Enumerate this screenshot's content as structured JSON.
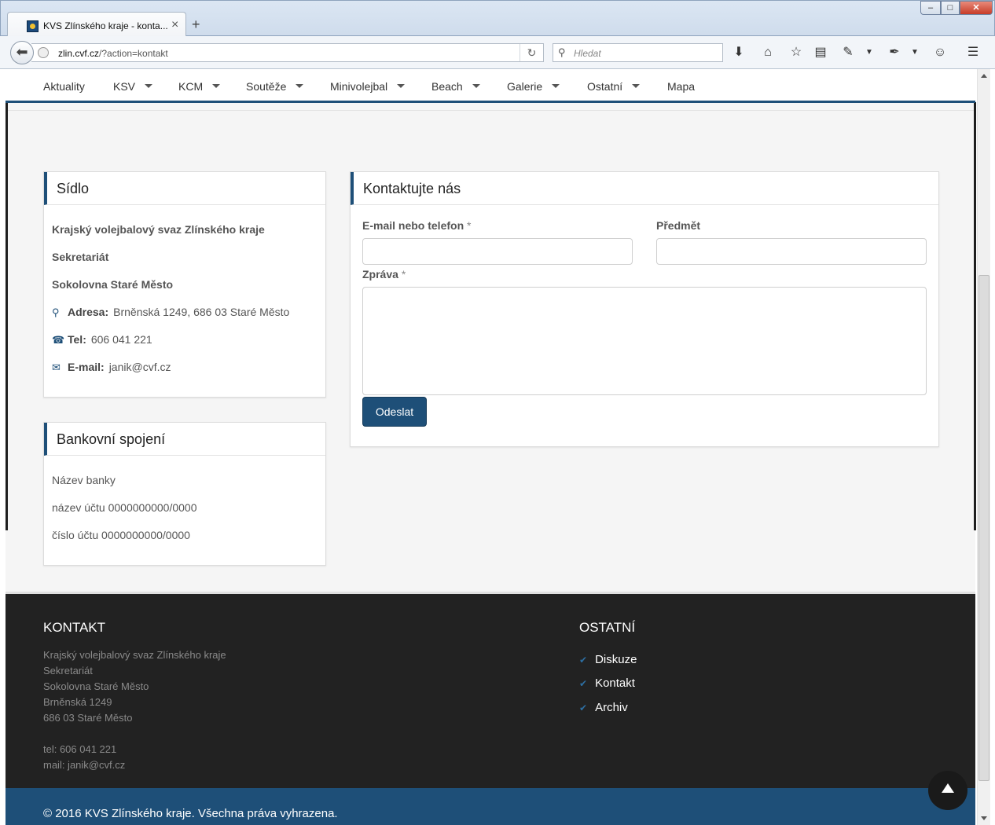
{
  "browser": {
    "tab_title": "KVS Zlínského kraje - konta...",
    "tab_close": "×",
    "new_tab": "+",
    "window_min": "–",
    "window_max": "□",
    "window_close": "✕",
    "url_host": "zlin.cvf.cz",
    "url_rest": "/?action=kontakt",
    "search_placeholder": "Hledat"
  },
  "nav": {
    "items": [
      {
        "label": "Aktuality",
        "dropdown": false
      },
      {
        "label": "KSV",
        "dropdown": true
      },
      {
        "label": "KCM",
        "dropdown": true
      },
      {
        "label": "Soutěže",
        "dropdown": true
      },
      {
        "label": "Minivolejbal",
        "dropdown": true
      },
      {
        "label": "Beach",
        "dropdown": true
      },
      {
        "label": "Galerie",
        "dropdown": true
      },
      {
        "label": "Ostatní",
        "dropdown": true
      },
      {
        "label": "Mapa",
        "dropdown": false
      }
    ]
  },
  "sidlo": {
    "title": "Sídlo",
    "org": "Krajský volejbalový svaz Zlínského kraje",
    "dept": "Sekretariát",
    "place": "Sokolovna Staré Město",
    "address_label": "Adresa:",
    "address": "Brněnská 1249, 686 03 Staré Město",
    "phone_label": "Tel:",
    "phone": "606 041 221",
    "email_label": "E-mail:",
    "email": "janik@cvf.cz"
  },
  "bank": {
    "title": "Bankovní spojení",
    "bank_name": "Název banky",
    "account_name": "název účtu 0000000000/0000",
    "account_number": "číslo účtu 0000000000/0000"
  },
  "contact_form": {
    "title": "Kontaktujte nás",
    "email_label": "E-mail nebo telefon",
    "subject_label": "Předmět",
    "message_label": "Zpráva",
    "required_mark": "*",
    "email_value": "",
    "subject_value": "",
    "message_value": "",
    "submit_label": "Odeslat"
  },
  "footer": {
    "contact_title": "KONTAKT",
    "contact_lines": [
      "Krajský volejbalový svaz Zlínského kraje",
      "Sekretariát",
      "Sokolovna Staré Město",
      "Brněnská 1249",
      "686 03 Staré Město",
      "",
      "tel: 606 041 221",
      "mail: janik@cvf.cz"
    ],
    "other_title": "OSTATNÍ",
    "other_links": [
      "Diskuze",
      "Kontakt",
      "Archiv"
    ],
    "copyright": "© 2016 KVS Zlínského kraje.  Všechna práva vyhrazena."
  },
  "colors": {
    "accent": "#1e4f78",
    "footer_bg": "#222222",
    "page_bg": "#f5f5f5"
  }
}
